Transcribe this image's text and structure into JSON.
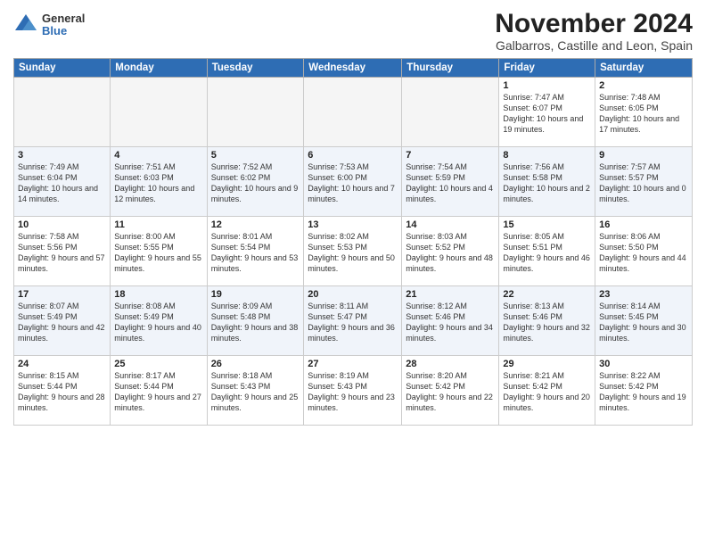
{
  "logo": {
    "general": "General",
    "blue": "Blue"
  },
  "title": "November 2024",
  "subtitle": "Galbarros, Castille and Leon, Spain",
  "headers": [
    "Sunday",
    "Monday",
    "Tuesday",
    "Wednesday",
    "Thursday",
    "Friday",
    "Saturday"
  ],
  "weeks": [
    [
      {
        "day": "",
        "info": ""
      },
      {
        "day": "",
        "info": ""
      },
      {
        "day": "",
        "info": ""
      },
      {
        "day": "",
        "info": ""
      },
      {
        "day": "",
        "info": ""
      },
      {
        "day": "1",
        "info": "Sunrise: 7:47 AM\nSunset: 6:07 PM\nDaylight: 10 hours and 19 minutes."
      },
      {
        "day": "2",
        "info": "Sunrise: 7:48 AM\nSunset: 6:05 PM\nDaylight: 10 hours and 17 minutes."
      }
    ],
    [
      {
        "day": "3",
        "info": "Sunrise: 7:49 AM\nSunset: 6:04 PM\nDaylight: 10 hours and 14 minutes."
      },
      {
        "day": "4",
        "info": "Sunrise: 7:51 AM\nSunset: 6:03 PM\nDaylight: 10 hours and 12 minutes."
      },
      {
        "day": "5",
        "info": "Sunrise: 7:52 AM\nSunset: 6:02 PM\nDaylight: 10 hours and 9 minutes."
      },
      {
        "day": "6",
        "info": "Sunrise: 7:53 AM\nSunset: 6:00 PM\nDaylight: 10 hours and 7 minutes."
      },
      {
        "day": "7",
        "info": "Sunrise: 7:54 AM\nSunset: 5:59 PM\nDaylight: 10 hours and 4 minutes."
      },
      {
        "day": "8",
        "info": "Sunrise: 7:56 AM\nSunset: 5:58 PM\nDaylight: 10 hours and 2 minutes."
      },
      {
        "day": "9",
        "info": "Sunrise: 7:57 AM\nSunset: 5:57 PM\nDaylight: 10 hours and 0 minutes."
      }
    ],
    [
      {
        "day": "10",
        "info": "Sunrise: 7:58 AM\nSunset: 5:56 PM\nDaylight: 9 hours and 57 minutes."
      },
      {
        "day": "11",
        "info": "Sunrise: 8:00 AM\nSunset: 5:55 PM\nDaylight: 9 hours and 55 minutes."
      },
      {
        "day": "12",
        "info": "Sunrise: 8:01 AM\nSunset: 5:54 PM\nDaylight: 9 hours and 53 minutes."
      },
      {
        "day": "13",
        "info": "Sunrise: 8:02 AM\nSunset: 5:53 PM\nDaylight: 9 hours and 50 minutes."
      },
      {
        "day": "14",
        "info": "Sunrise: 8:03 AM\nSunset: 5:52 PM\nDaylight: 9 hours and 48 minutes."
      },
      {
        "day": "15",
        "info": "Sunrise: 8:05 AM\nSunset: 5:51 PM\nDaylight: 9 hours and 46 minutes."
      },
      {
        "day": "16",
        "info": "Sunrise: 8:06 AM\nSunset: 5:50 PM\nDaylight: 9 hours and 44 minutes."
      }
    ],
    [
      {
        "day": "17",
        "info": "Sunrise: 8:07 AM\nSunset: 5:49 PM\nDaylight: 9 hours and 42 minutes."
      },
      {
        "day": "18",
        "info": "Sunrise: 8:08 AM\nSunset: 5:49 PM\nDaylight: 9 hours and 40 minutes."
      },
      {
        "day": "19",
        "info": "Sunrise: 8:09 AM\nSunset: 5:48 PM\nDaylight: 9 hours and 38 minutes."
      },
      {
        "day": "20",
        "info": "Sunrise: 8:11 AM\nSunset: 5:47 PM\nDaylight: 9 hours and 36 minutes."
      },
      {
        "day": "21",
        "info": "Sunrise: 8:12 AM\nSunset: 5:46 PM\nDaylight: 9 hours and 34 minutes."
      },
      {
        "day": "22",
        "info": "Sunrise: 8:13 AM\nSunset: 5:46 PM\nDaylight: 9 hours and 32 minutes."
      },
      {
        "day": "23",
        "info": "Sunrise: 8:14 AM\nSunset: 5:45 PM\nDaylight: 9 hours and 30 minutes."
      }
    ],
    [
      {
        "day": "24",
        "info": "Sunrise: 8:15 AM\nSunset: 5:44 PM\nDaylight: 9 hours and 28 minutes."
      },
      {
        "day": "25",
        "info": "Sunrise: 8:17 AM\nSunset: 5:44 PM\nDaylight: 9 hours and 27 minutes."
      },
      {
        "day": "26",
        "info": "Sunrise: 8:18 AM\nSunset: 5:43 PM\nDaylight: 9 hours and 25 minutes."
      },
      {
        "day": "27",
        "info": "Sunrise: 8:19 AM\nSunset: 5:43 PM\nDaylight: 9 hours and 23 minutes."
      },
      {
        "day": "28",
        "info": "Sunrise: 8:20 AM\nSunset: 5:42 PM\nDaylight: 9 hours and 22 minutes."
      },
      {
        "day": "29",
        "info": "Sunrise: 8:21 AM\nSunset: 5:42 PM\nDaylight: 9 hours and 20 minutes."
      },
      {
        "day": "30",
        "info": "Sunrise: 8:22 AM\nSunset: 5:42 PM\nDaylight: 9 hours and 19 minutes."
      }
    ]
  ]
}
